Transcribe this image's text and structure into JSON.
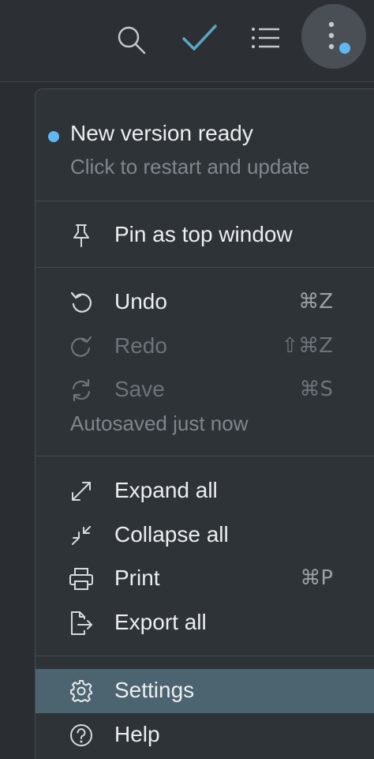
{
  "colors": {
    "accent": "#5fb8f2",
    "check": "#5aa6c4",
    "selected_bg": "#4b6470"
  },
  "toolbar": {
    "buttons": [
      {
        "name": "search",
        "icon": "search-icon"
      },
      {
        "name": "done",
        "icon": "check-icon"
      },
      {
        "name": "list",
        "icon": "list-icon"
      },
      {
        "name": "more",
        "icon": "more-vertical-icon"
      }
    ]
  },
  "menu": {
    "update": {
      "title": "New version ready",
      "subtitle": "Click to restart and update"
    },
    "pin": {
      "label": "Pin as top window",
      "icon": "pin-icon"
    },
    "undo": {
      "label": "Undo",
      "shortcut": "⌘Z",
      "icon": "undo-icon"
    },
    "redo": {
      "label": "Redo",
      "shortcut": "⇧⌘Z",
      "icon": "redo-icon"
    },
    "save": {
      "label": "Save",
      "shortcut": "⌘S",
      "icon": "sync-icon"
    },
    "autosave_note": "Autosaved just now",
    "expand_all": {
      "label": "Expand all",
      "icon": "expand-icon"
    },
    "collapse_all": {
      "label": "Collapse all",
      "icon": "collapse-icon"
    },
    "print": {
      "label": "Print",
      "shortcut": "⌘P",
      "icon": "printer-icon"
    },
    "export_all": {
      "label": "Export all",
      "icon": "export-icon"
    },
    "settings": {
      "label": "Settings",
      "icon": "gear-icon"
    },
    "help": {
      "label": "Help",
      "icon": "help-icon"
    }
  }
}
